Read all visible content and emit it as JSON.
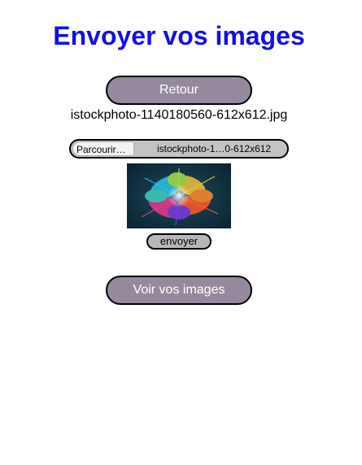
{
  "page": {
    "title": "Envoyer vos images"
  },
  "buttons": {
    "back_label": "Retour",
    "send_label": "envoyer",
    "view_label": "Voir vos images"
  },
  "upload": {
    "selected_filename": "istockphoto-1140180560-612x612.jpg",
    "browse_label": "Parcourir…",
    "input_filename": "istockphoto-1…0-612x612"
  },
  "colors": {
    "title": "#1010e6",
    "button_fill": "#958a9d",
    "button_text": "#ffffff",
    "input_fill": "#c3c3c6",
    "send_fill": "#b7b7bb"
  },
  "preview": {
    "icon": "color-powder-explosion-image"
  }
}
